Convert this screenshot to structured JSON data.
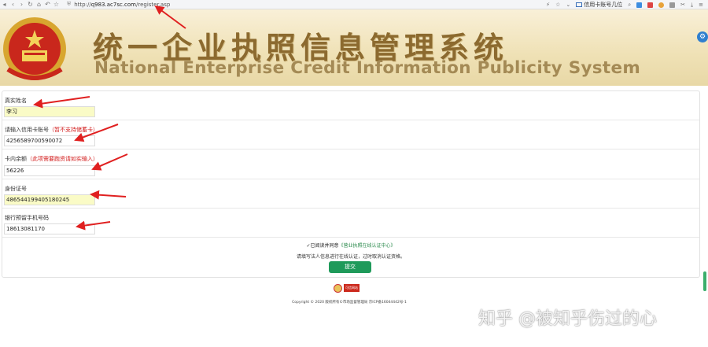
{
  "browser": {
    "url_prefix": "http://",
    "url_host": "q983.ac7sc.com",
    "url_path": "/register.asp",
    "bookmark_label": "信用卡账号几位"
  },
  "banner": {
    "title_cn": "统一企业执照信息管理系统",
    "title_en": "National Enterprise Credit Information Publicity System"
  },
  "form": {
    "fields": [
      {
        "label": "真实姓名",
        "note": "",
        "value": "李习",
        "highlighted": true
      },
      {
        "label": "请输入信用卡账号",
        "note": "（暂不支持储蓄卡）",
        "value": "4256589700590072",
        "highlighted": false
      },
      {
        "label": "卡内余额",
        "note": "（此项需要跑资请如实输入）",
        "value": "56226",
        "highlighted": false
      },
      {
        "label": "身份证号",
        "note": "",
        "value": "486544199405180245",
        "highlighted": true
      },
      {
        "label": "银行预留手机号码",
        "note": "",
        "value": "18613081170",
        "highlighted": false
      }
    ],
    "agree_prefix": "✓已阅读并同意",
    "agree_link": "《营业执照在线认证中心》",
    "hint": "请填写法人信息进行在线认证，过时取消认证资格。",
    "submit_label": "提交"
  },
  "footer": {
    "badge_text": "可信网站",
    "copyright": "Copyright © 2020 版权所有©市场监督管理局 京ICP备16044442号-1"
  },
  "watermark": "知乎 @被知乎伤过的心",
  "colors": {
    "accent_green": "#1f9a5a",
    "note_red": "#d21a1a",
    "highlight_yellow": "#fafbc6",
    "arrow_red": "#e02020"
  }
}
